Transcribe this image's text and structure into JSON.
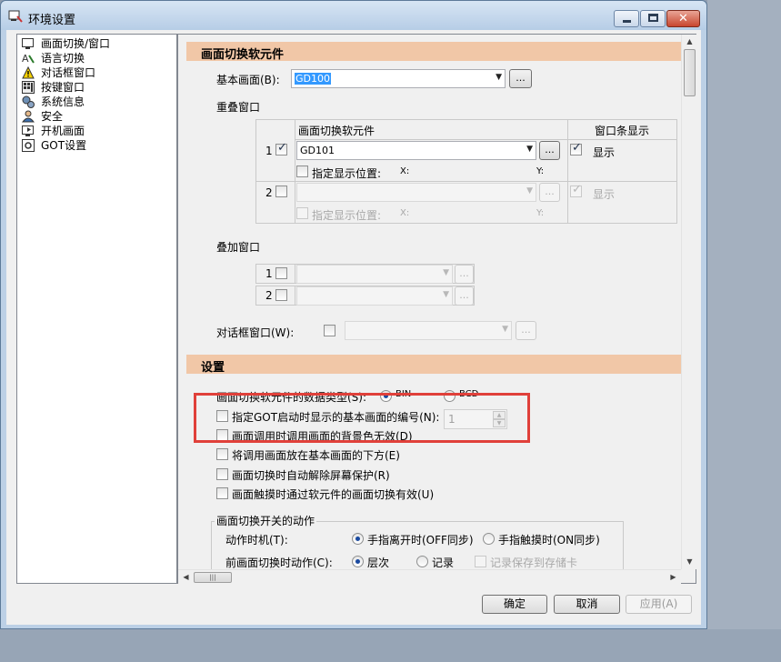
{
  "window": {
    "title": "环境设置"
  },
  "tree": {
    "items": [
      {
        "label": "画面切换/窗口",
        "icon": "screen-switch-icon"
      },
      {
        "label": "语言切换",
        "icon": "language-icon"
      },
      {
        "label": "对话框窗口",
        "icon": "dialog-window-icon"
      },
      {
        "label": "按键窗口",
        "icon": "keypad-icon"
      },
      {
        "label": "系统信息",
        "icon": "system-info-icon"
      },
      {
        "label": "安全",
        "icon": "security-icon"
      },
      {
        "label": "开机画面",
        "icon": "startup-screen-icon"
      },
      {
        "label": "GOT设置",
        "icon": "got-settings-icon"
      }
    ]
  },
  "section1": {
    "title": "画面切换软元件"
  },
  "base_screen": {
    "label": "基本画面(B):",
    "value": "GD100"
  },
  "overlap": {
    "title": "重叠窗口",
    "col_device": "画面切换软元件",
    "col_bar": "窗口条显示",
    "rows": [
      {
        "num": "1",
        "value": "GD101",
        "show": "显示",
        "pos_label": "指定显示位置:",
        "x_label": "X:",
        "y_label": "Y:"
      },
      {
        "num": "2",
        "value": "",
        "show": "显示",
        "pos_label": "指定显示位置:",
        "x_label": "X:",
        "y_label": "Y:"
      }
    ]
  },
  "superimpose": {
    "title": "叠加窗口",
    "rows": [
      {
        "num": "1"
      },
      {
        "num": "2"
      }
    ]
  },
  "dialog": {
    "label": "对话框窗口(W):"
  },
  "dots": "...",
  "section2": {
    "title": "设置"
  },
  "settings": {
    "data_type_label": "画面切换软元件的数据类型(S):",
    "bin": "BIN",
    "bcd": "BCD",
    "startup_label": "指定GOT启动时显示的基本画面的编号(N):",
    "startup_value": "1",
    "bg_label": "画面调用时调用画面的背景色无效(D)",
    "below_label": "将调用画面放在基本画面的下方(E)",
    "auto_release_label": "画面切换时自动解除屏幕保护(R)",
    "touch_label": "画面触摸时通过软元件的画面切换有效(U)"
  },
  "switch_action": {
    "title": "画面切换开关的动作",
    "timing_label": "动作时机(T):",
    "timing_opt1": "手指离开时(OFF同步)",
    "timing_opt2": "手指触摸时(ON同步)",
    "prev_label": "前画面切换时动作(C):",
    "prev_opt1": "层次",
    "prev_opt2": "记录",
    "save_label": "记录保存到存储卡"
  },
  "buttons": {
    "ok": "确定",
    "cancel": "取消",
    "apply": "应用(A)"
  },
  "colors": {
    "section": "#f1c7a7",
    "highlight": "#e0403a"
  }
}
